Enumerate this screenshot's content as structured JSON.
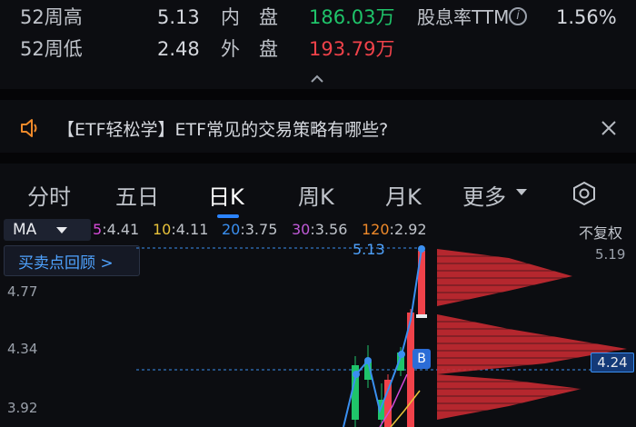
{
  "stats": {
    "row1": {
      "label": "52周高",
      "value": "5.13",
      "label2": "内　盘",
      "value2": "186.03万",
      "label3": "股息率TTM",
      "value3": "1.56%"
    },
    "row2": {
      "label": "52周低",
      "value": "2.48",
      "label2": "外　盘",
      "value2": "193.79万"
    }
  },
  "notice": {
    "text": "【ETF轻松学】ETF常见的交易策略有哪些?"
  },
  "tabs": [
    "分时",
    "五日",
    "日K",
    "周K",
    "月K",
    "更多"
  ],
  "active_tab": "日K",
  "chart": {
    "ma_label": "MA",
    "ma": [
      {
        "key": "5",
        "value": ":4.41",
        "color": "#d64ad8"
      },
      {
        "key": "10",
        "value": ":4.11",
        "color": "#e8c23a"
      },
      {
        "key": "20",
        "value": ":3.75",
        "color": "#3a8ff0"
      },
      {
        "key": "30",
        "value": ":3.56",
        "color": "#c05ad8"
      },
      {
        "key": "120",
        "value": ":2.92",
        "color": "#f08a2a"
      }
    ],
    "adjust": "不复权",
    "buysell": "买卖点回顾 >",
    "y_labels": [
      "5.19",
      "4.77",
      "4.34",
      "3.92"
    ],
    "high_marker": "5.13",
    "current_price": "4.24",
    "b_marker": "B"
  },
  "colors": {
    "up": "#f0424a",
    "down": "#1fc46a",
    "accent": "#2b84ff"
  }
}
